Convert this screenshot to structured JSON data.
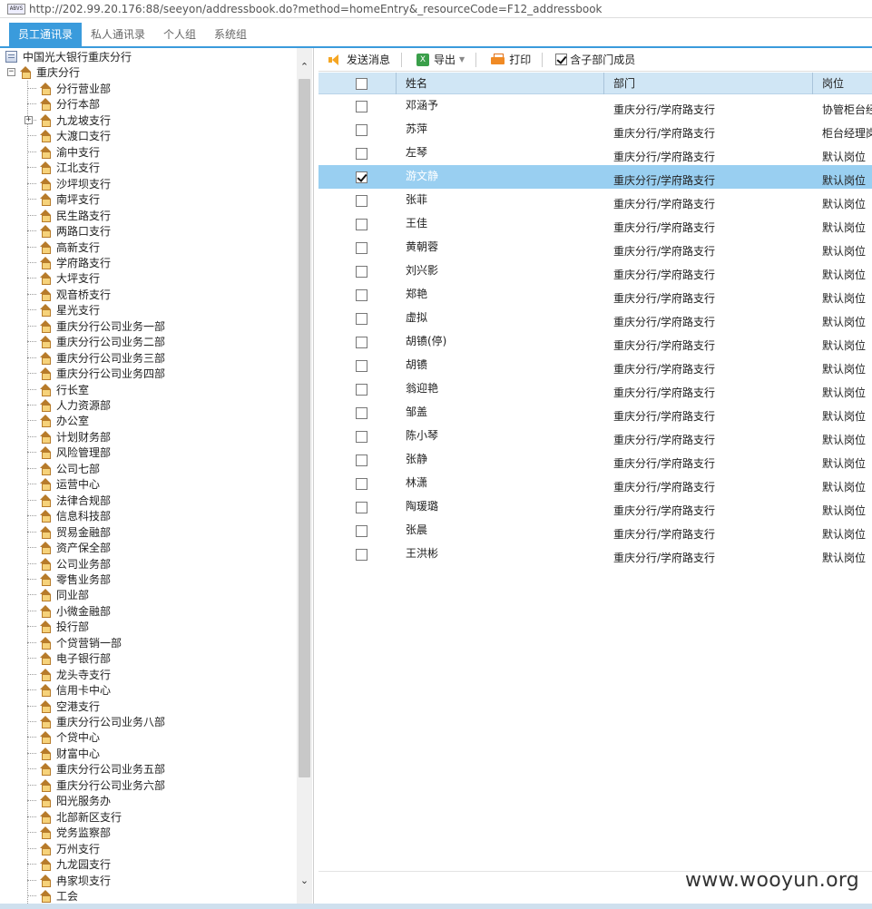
{
  "address_bar": {
    "favicon_text": "ABVS",
    "url": "http://202.99.20.176:88/seeyon/addressbook.do?method=homeEntry&_resourceCode=F12_addressbook"
  },
  "tabs": [
    {
      "label": "员工通讯录",
      "active": true
    },
    {
      "label": "私人通讯录",
      "active": false
    },
    {
      "label": "个人组",
      "active": false
    },
    {
      "label": "系统组",
      "active": false
    }
  ],
  "tree": {
    "root": "中国光大银行重庆分行",
    "branch": "重庆分行",
    "expander_minus": "−",
    "expander_plus": "+",
    "items": [
      "分行营业部",
      "分行本部",
      "九龙坡支行",
      "大渡口支行",
      "渝中支行",
      "江北支行",
      "沙坪坝支行",
      "南坪支行",
      "民生路支行",
      "两路口支行",
      "高新支行",
      "学府路支行",
      "大坪支行",
      "观音桥支行",
      "星光支行",
      "重庆分行公司业务一部",
      "重庆分行公司业务二部",
      "重庆分行公司业务三部",
      "重庆分行公司业务四部",
      "行长室",
      "人力资源部",
      "办公室",
      "计划财务部",
      "风险管理部",
      "公司七部",
      "运营中心",
      "法律合规部",
      "信息科技部",
      "贸易金融部",
      "资产保全部",
      "公司业务部",
      "零售业务部",
      "同业部",
      "小微金融部",
      "投行部",
      "个贷营销一部",
      "电子银行部",
      "龙头寺支行",
      "信用卡中心",
      "空港支行",
      "重庆分行公司业务八部",
      "个贷中心",
      "财富中心",
      "重庆分行公司业务五部",
      "重庆分行公司业务六部",
      "阳光服务办",
      "北部新区支行",
      "党务监察部",
      "万州支行",
      "九龙园支行",
      "冉家坝支行",
      "工会"
    ],
    "collapsed_item_index": 2
  },
  "scrollbar": {
    "up": "⌃",
    "down": "⌄"
  },
  "toolbar": {
    "send_message": "发送消息",
    "export": "导出",
    "excel_icon_text": "X",
    "export_caret": "▼",
    "print": "打印",
    "include_sub": "含子部门成员",
    "include_sub_checked": true
  },
  "grid": {
    "columns": [
      "姓名",
      "部门",
      "岗位"
    ],
    "rows": [
      {
        "name": "邓涵予",
        "dept": "重庆分行/学府路支行",
        "post": "协管柜台经",
        "selected": false
      },
      {
        "name": "苏萍",
        "dept": "重庆分行/学府路支行",
        "post": "柜台经理岗",
        "selected": false
      },
      {
        "name": "左琴",
        "dept": "重庆分行/学府路支行",
        "post": "默认岗位",
        "selected": false
      },
      {
        "name": "游文静",
        "dept": "重庆分行/学府路支行",
        "post": "默认岗位",
        "selected": true
      },
      {
        "name": "张菲",
        "dept": "重庆分行/学府路支行",
        "post": "默认岗位",
        "selected": false
      },
      {
        "name": "王佳",
        "dept": "重庆分行/学府路支行",
        "post": "默认岗位",
        "selected": false
      },
      {
        "name": "黄朝蓉",
        "dept": "重庆分行/学府路支行",
        "post": "默认岗位",
        "selected": false
      },
      {
        "name": "刘兴影",
        "dept": "重庆分行/学府路支行",
        "post": "默认岗位",
        "selected": false
      },
      {
        "name": "郑艳",
        "dept": "重庆分行/学府路支行",
        "post": "默认岗位",
        "selected": false
      },
      {
        "name": "虚拟",
        "dept": "重庆分行/学府路支行",
        "post": "默认岗位",
        "selected": false
      },
      {
        "name": "胡镄(停)",
        "dept": "重庆分行/学府路支行",
        "post": "默认岗位",
        "selected": false
      },
      {
        "name": "胡镄",
        "dept": "重庆分行/学府路支行",
        "post": "默认岗位",
        "selected": false
      },
      {
        "name": "翁迎艳",
        "dept": "重庆分行/学府路支行",
        "post": "默认岗位",
        "selected": false
      },
      {
        "name": "邹盖",
        "dept": "重庆分行/学府路支行",
        "post": "默认岗位",
        "selected": false
      },
      {
        "name": "陈小琴",
        "dept": "重庆分行/学府路支行",
        "post": "默认岗位",
        "selected": false
      },
      {
        "name": "张静",
        "dept": "重庆分行/学府路支行",
        "post": "默认岗位",
        "selected": false
      },
      {
        "name": "林潇",
        "dept": "重庆分行/学府路支行",
        "post": "默认岗位",
        "selected": false
      },
      {
        "name": "陶瑗璐",
        "dept": "重庆分行/学府路支行",
        "post": "默认岗位",
        "selected": false
      },
      {
        "name": "张晨",
        "dept": "重庆分行/学府路支行",
        "post": "默认岗位",
        "selected": false
      },
      {
        "name": "王洪彬",
        "dept": "重庆分行/学府路支行",
        "post": "默认岗位",
        "selected": false
      }
    ]
  },
  "watermark": "www.wooyun.org"
}
